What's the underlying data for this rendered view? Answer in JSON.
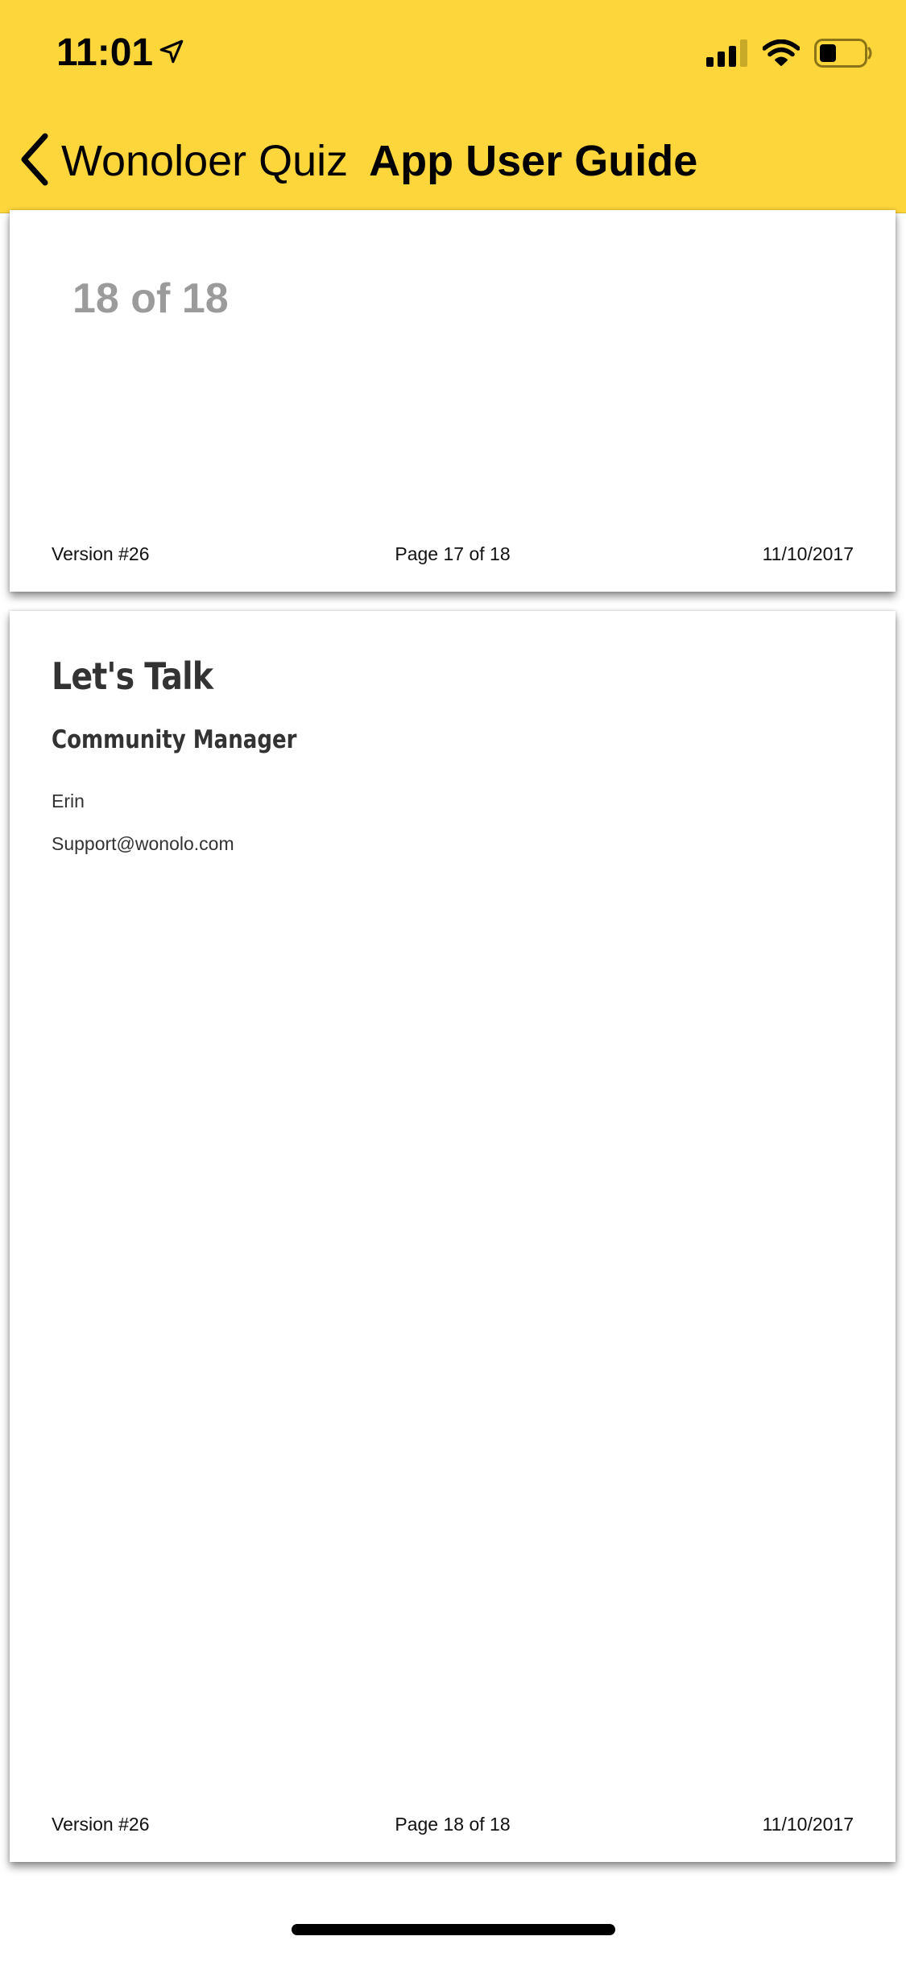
{
  "status_bar": {
    "time": "11:01",
    "location_icon": "location-arrow-icon",
    "signal_icon": "cellular-signal-icon",
    "wifi_icon": "wifi-icon",
    "battery_icon": "battery-icon"
  },
  "nav": {
    "back_label": "Wonoloer Quiz",
    "title": "App User Guide",
    "accent_color": "#fdd63b"
  },
  "pages": [
    {
      "counter": "18 of 18",
      "footer": {
        "version": "Version #26",
        "page": "Page 17 of 18",
        "date": "11/10/2017"
      }
    },
    {
      "heading": "Let's Talk",
      "subheading": "Community Manager",
      "name": "Erin",
      "email": "Support@wonolo.com",
      "footer": {
        "version": "Version #26",
        "page": "Page 18 of 18",
        "date": "11/10/2017"
      }
    }
  ]
}
